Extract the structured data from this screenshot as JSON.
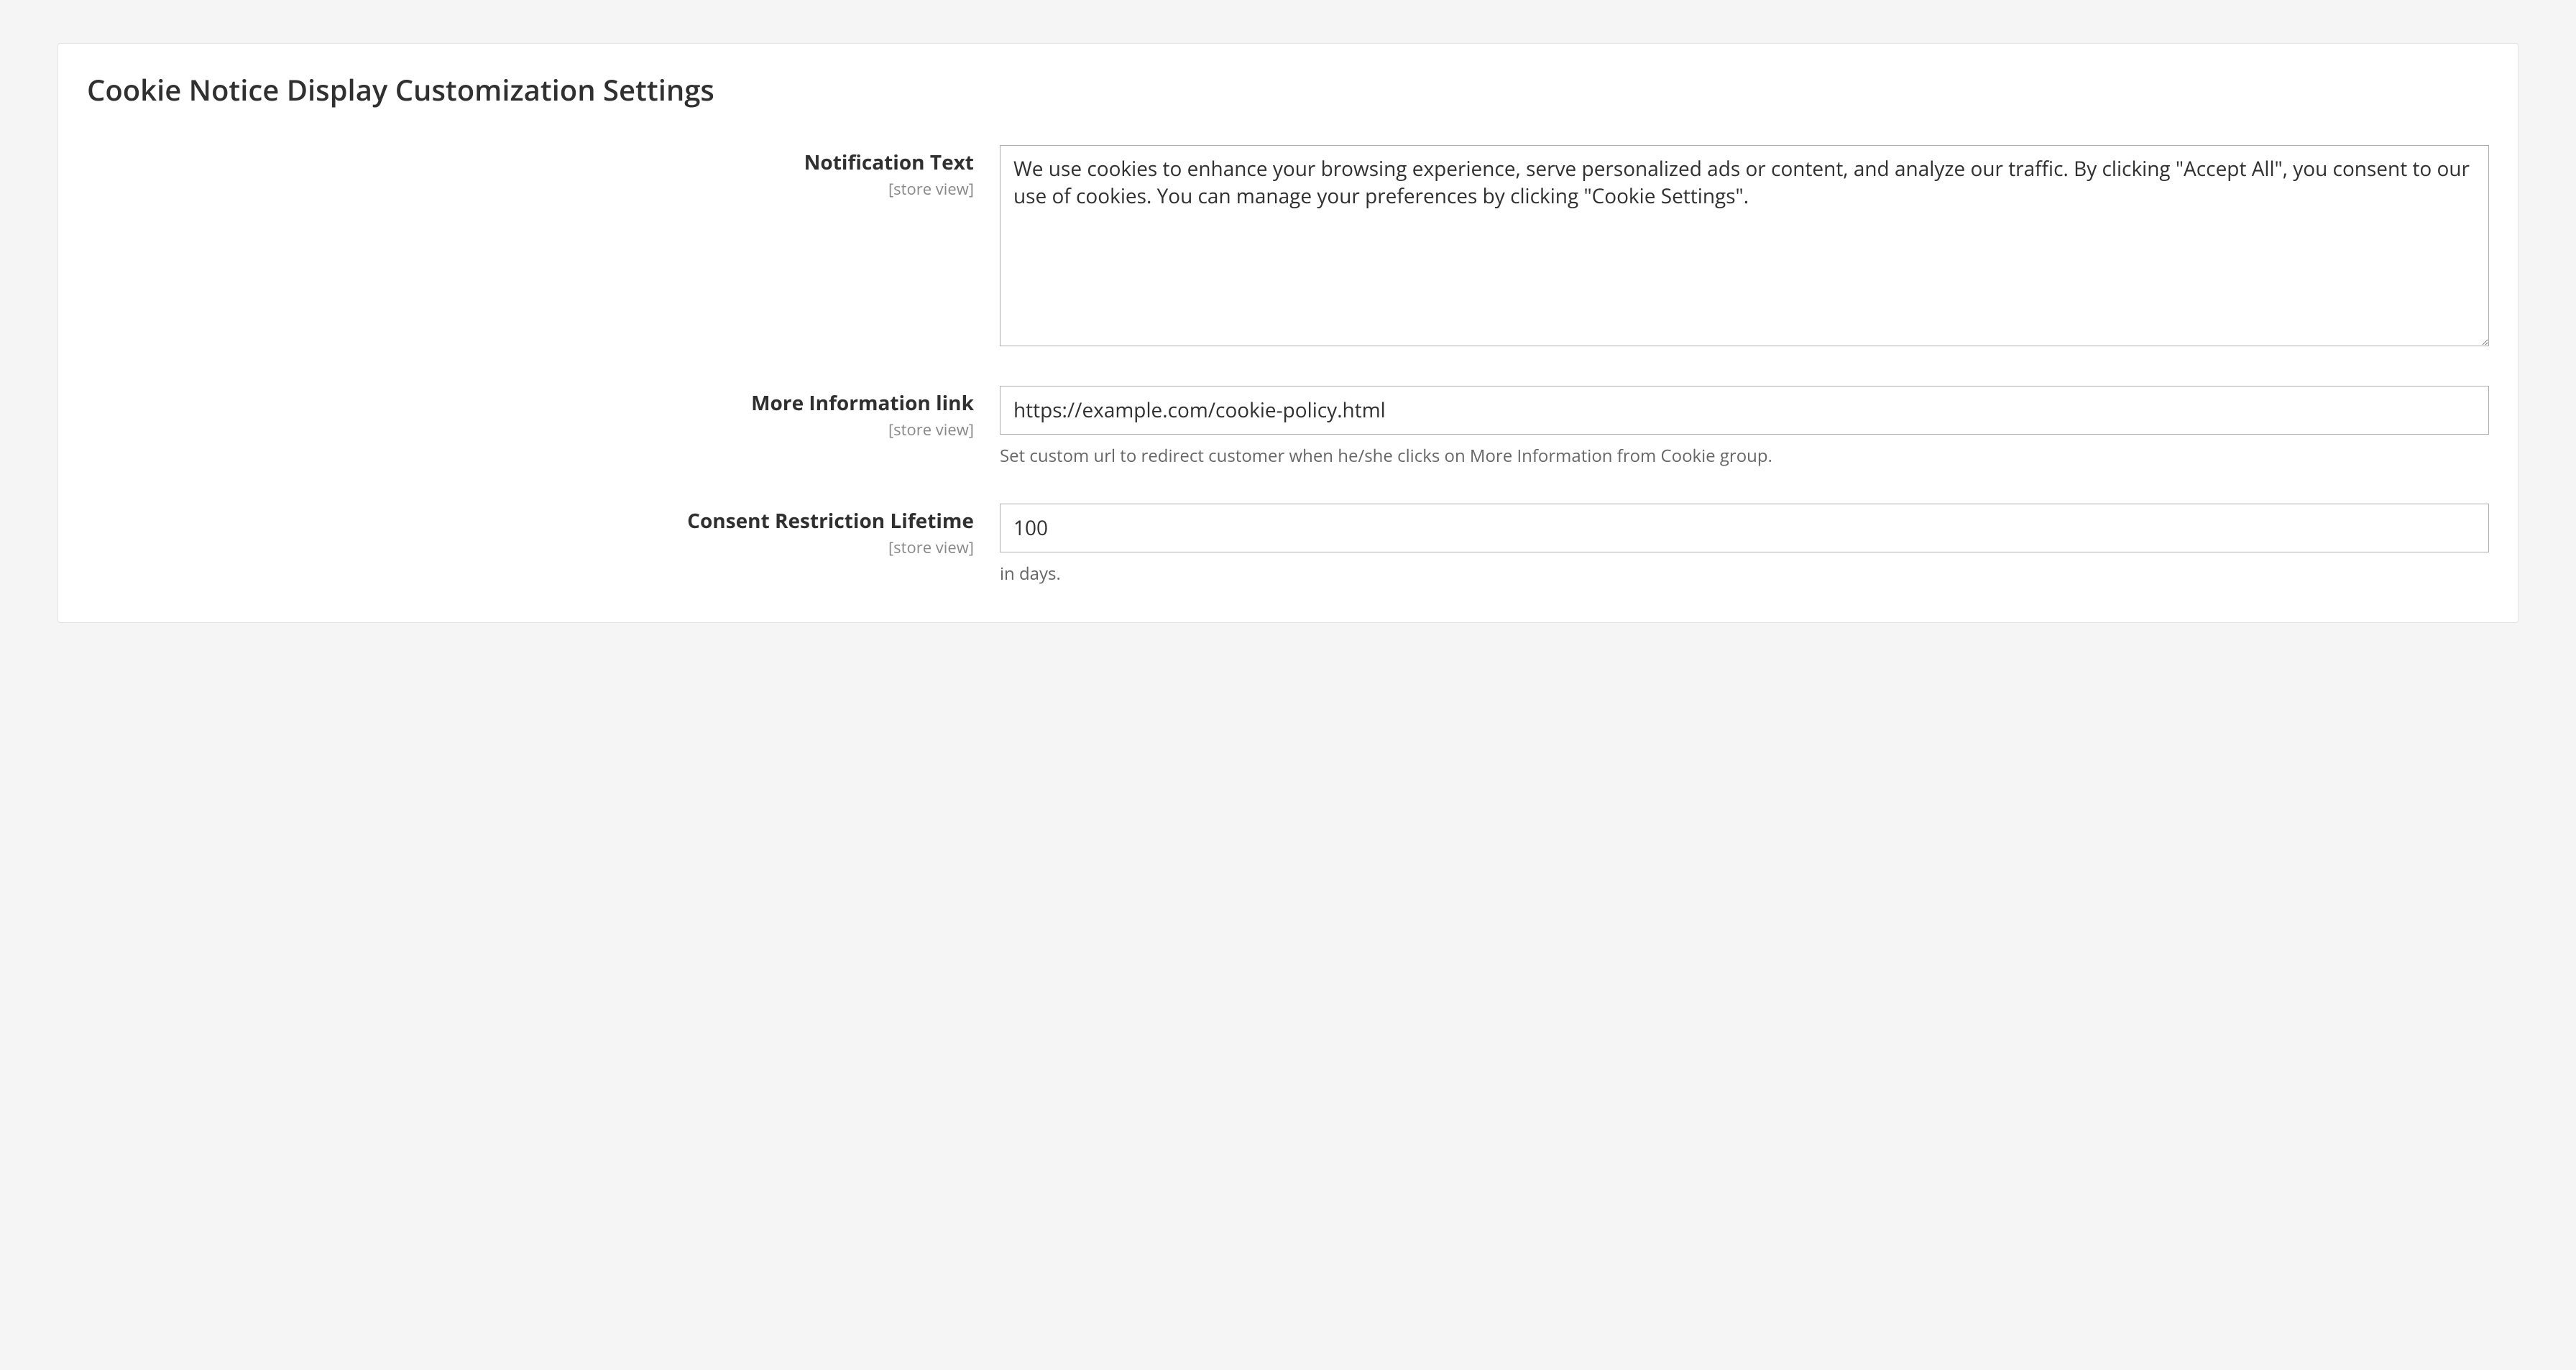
{
  "panel": {
    "title": "Cookie Notice Display Customization Settings"
  },
  "scope_label": "[store view]",
  "fields": {
    "notification_text": {
      "label": "Notification Text",
      "value": "We use cookies to enhance your browsing experience, serve personalized ads or content, and analyze our traffic. By clicking \"Accept All\", you consent to our use of cookies. You can manage your preferences by clicking \"Cookie Settings\"."
    },
    "more_info_link": {
      "label": "More Information link",
      "value": "https://example.com/cookie-policy.html",
      "note": "Set custom url to redirect customer when he/she clicks on More Information from Cookie group."
    },
    "consent_lifetime": {
      "label": "Consent Restriction Lifetime",
      "value": "100",
      "note": "in days."
    }
  }
}
